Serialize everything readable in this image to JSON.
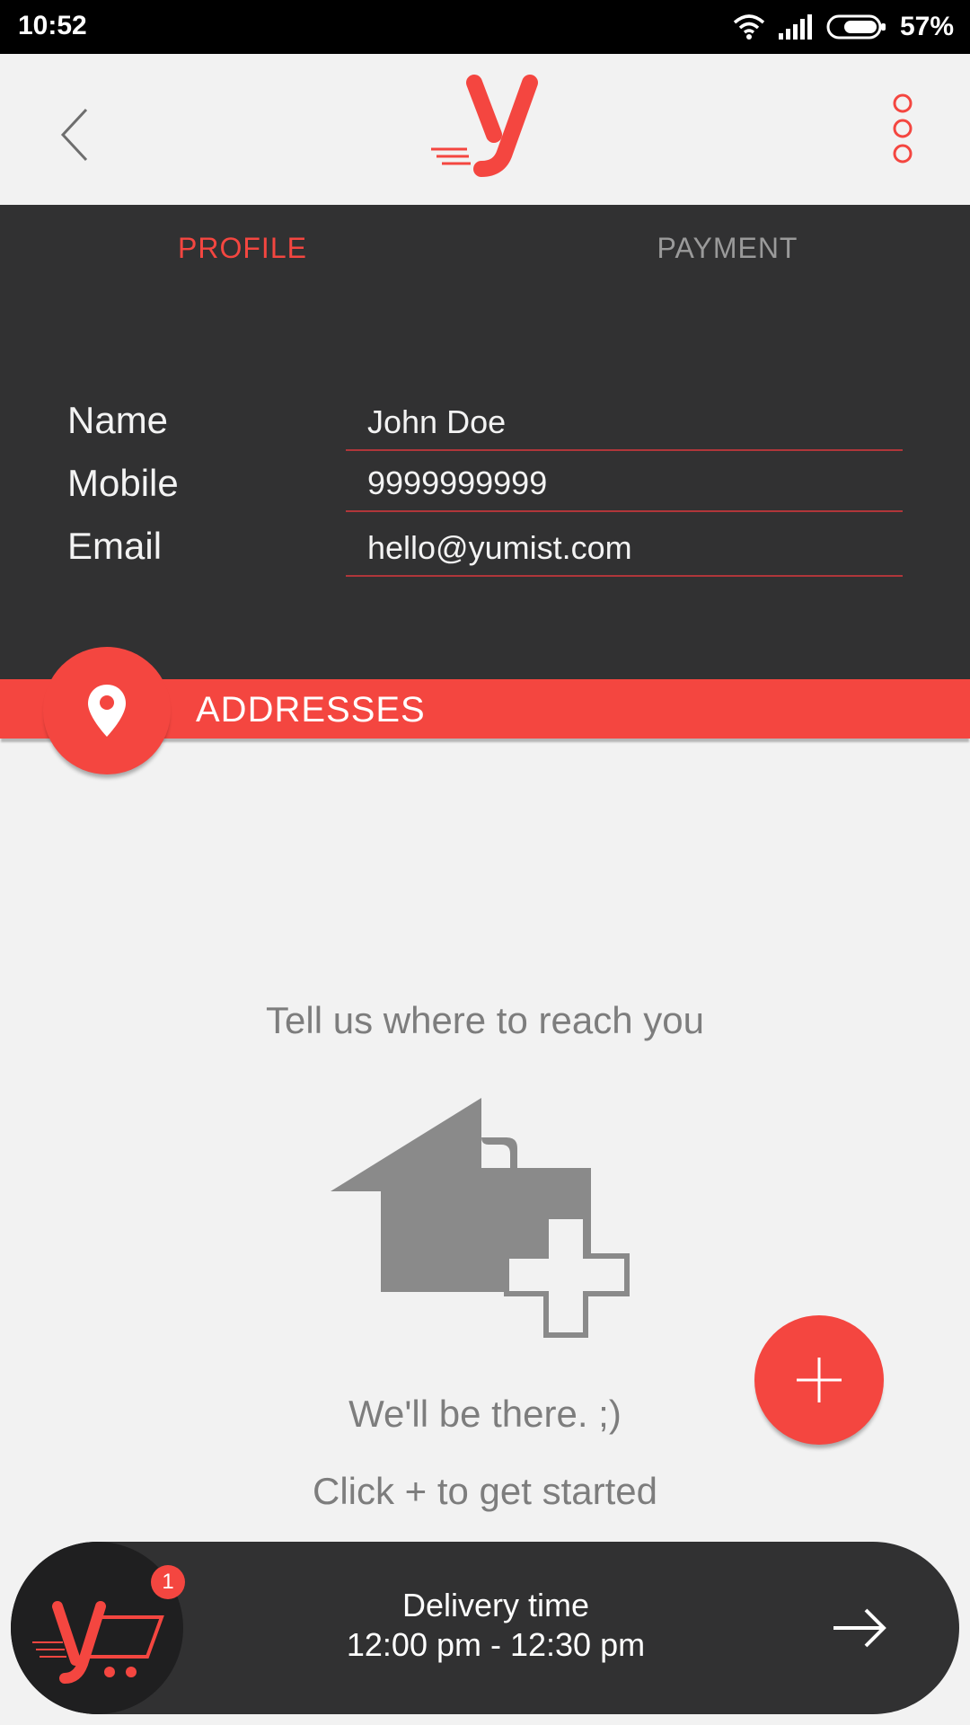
{
  "status_bar": {
    "time": "10:52",
    "battery": "57%"
  },
  "header": {
    "back_icon": "chevron-left-icon",
    "logo_letter": "y",
    "menu_icon": "three-dots-vertical-icon"
  },
  "tabs": [
    {
      "label": "PROFILE",
      "active": true
    },
    {
      "label": "PAYMENT",
      "active": false
    }
  ],
  "profile": {
    "name_label": "Name",
    "name_value": "John Doe",
    "mobile_label": "Mobile",
    "mobile_value": "9999999999",
    "email_label": "Email",
    "email_value": "hello@yumist.com"
  },
  "addresses": {
    "title": "ADDRESSES",
    "empty_title": "Tell us where to reach you",
    "empty_sub1": "We'll be there. ;)",
    "empty_sub2": "Click + to get started"
  },
  "cart": {
    "badge_count": "1",
    "delivery_label": "Delivery time",
    "delivery_time": "12:00 pm - 12:30 pm"
  },
  "colors": {
    "accent": "#f44640",
    "dark": "#313132",
    "background": "#f2f2f2"
  }
}
